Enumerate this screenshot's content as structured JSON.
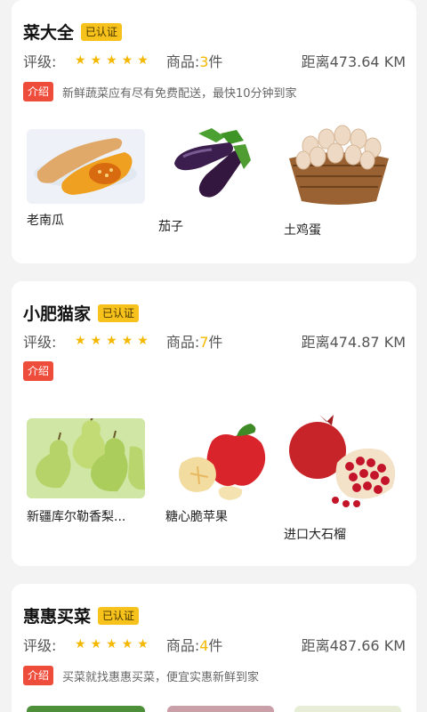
{
  "shops": [
    {
      "name": "菜大全",
      "badge": "已认证",
      "rating_label": "评级:",
      "stars": 5,
      "goods_prefix": "商品:",
      "goods_count": "3",
      "goods_suffix": "件",
      "distance": "距离473.64 KM",
      "intro_tag": "介绍",
      "intro_text": "新鲜蔬菜应有尽有免费配送，最快10分钟到家",
      "products": [
        "老南瓜",
        "茄子",
        "土鸡蛋"
      ]
    },
    {
      "name": "小肥猫家",
      "badge": "已认证",
      "rating_label": "评级:",
      "stars": 5,
      "goods_prefix": "商品:",
      "goods_count": "7",
      "goods_suffix": "件",
      "distance": "距离474.87 KM",
      "intro_tag": "介绍",
      "intro_text": "",
      "products": [
        "新疆库尔勒香梨...",
        "糖心脆苹果",
        "进口大石榴"
      ]
    },
    {
      "name": "惠惠买菜",
      "badge": "已认证",
      "rating_label": "评级:",
      "stars": 5,
      "goods_prefix": "商品:",
      "goods_count": "4",
      "goods_suffix": "件",
      "distance": "距离487.66 KM",
      "intro_tag": "介绍",
      "intro_text": "买菜就找惠惠买菜，便宜实惠新鲜到家",
      "products": []
    }
  ],
  "icons": {
    "star": "star-icon"
  },
  "colors": {
    "badge": "#f7c21b",
    "intro": "#ef4d3c",
    "star": "#f5b800"
  }
}
